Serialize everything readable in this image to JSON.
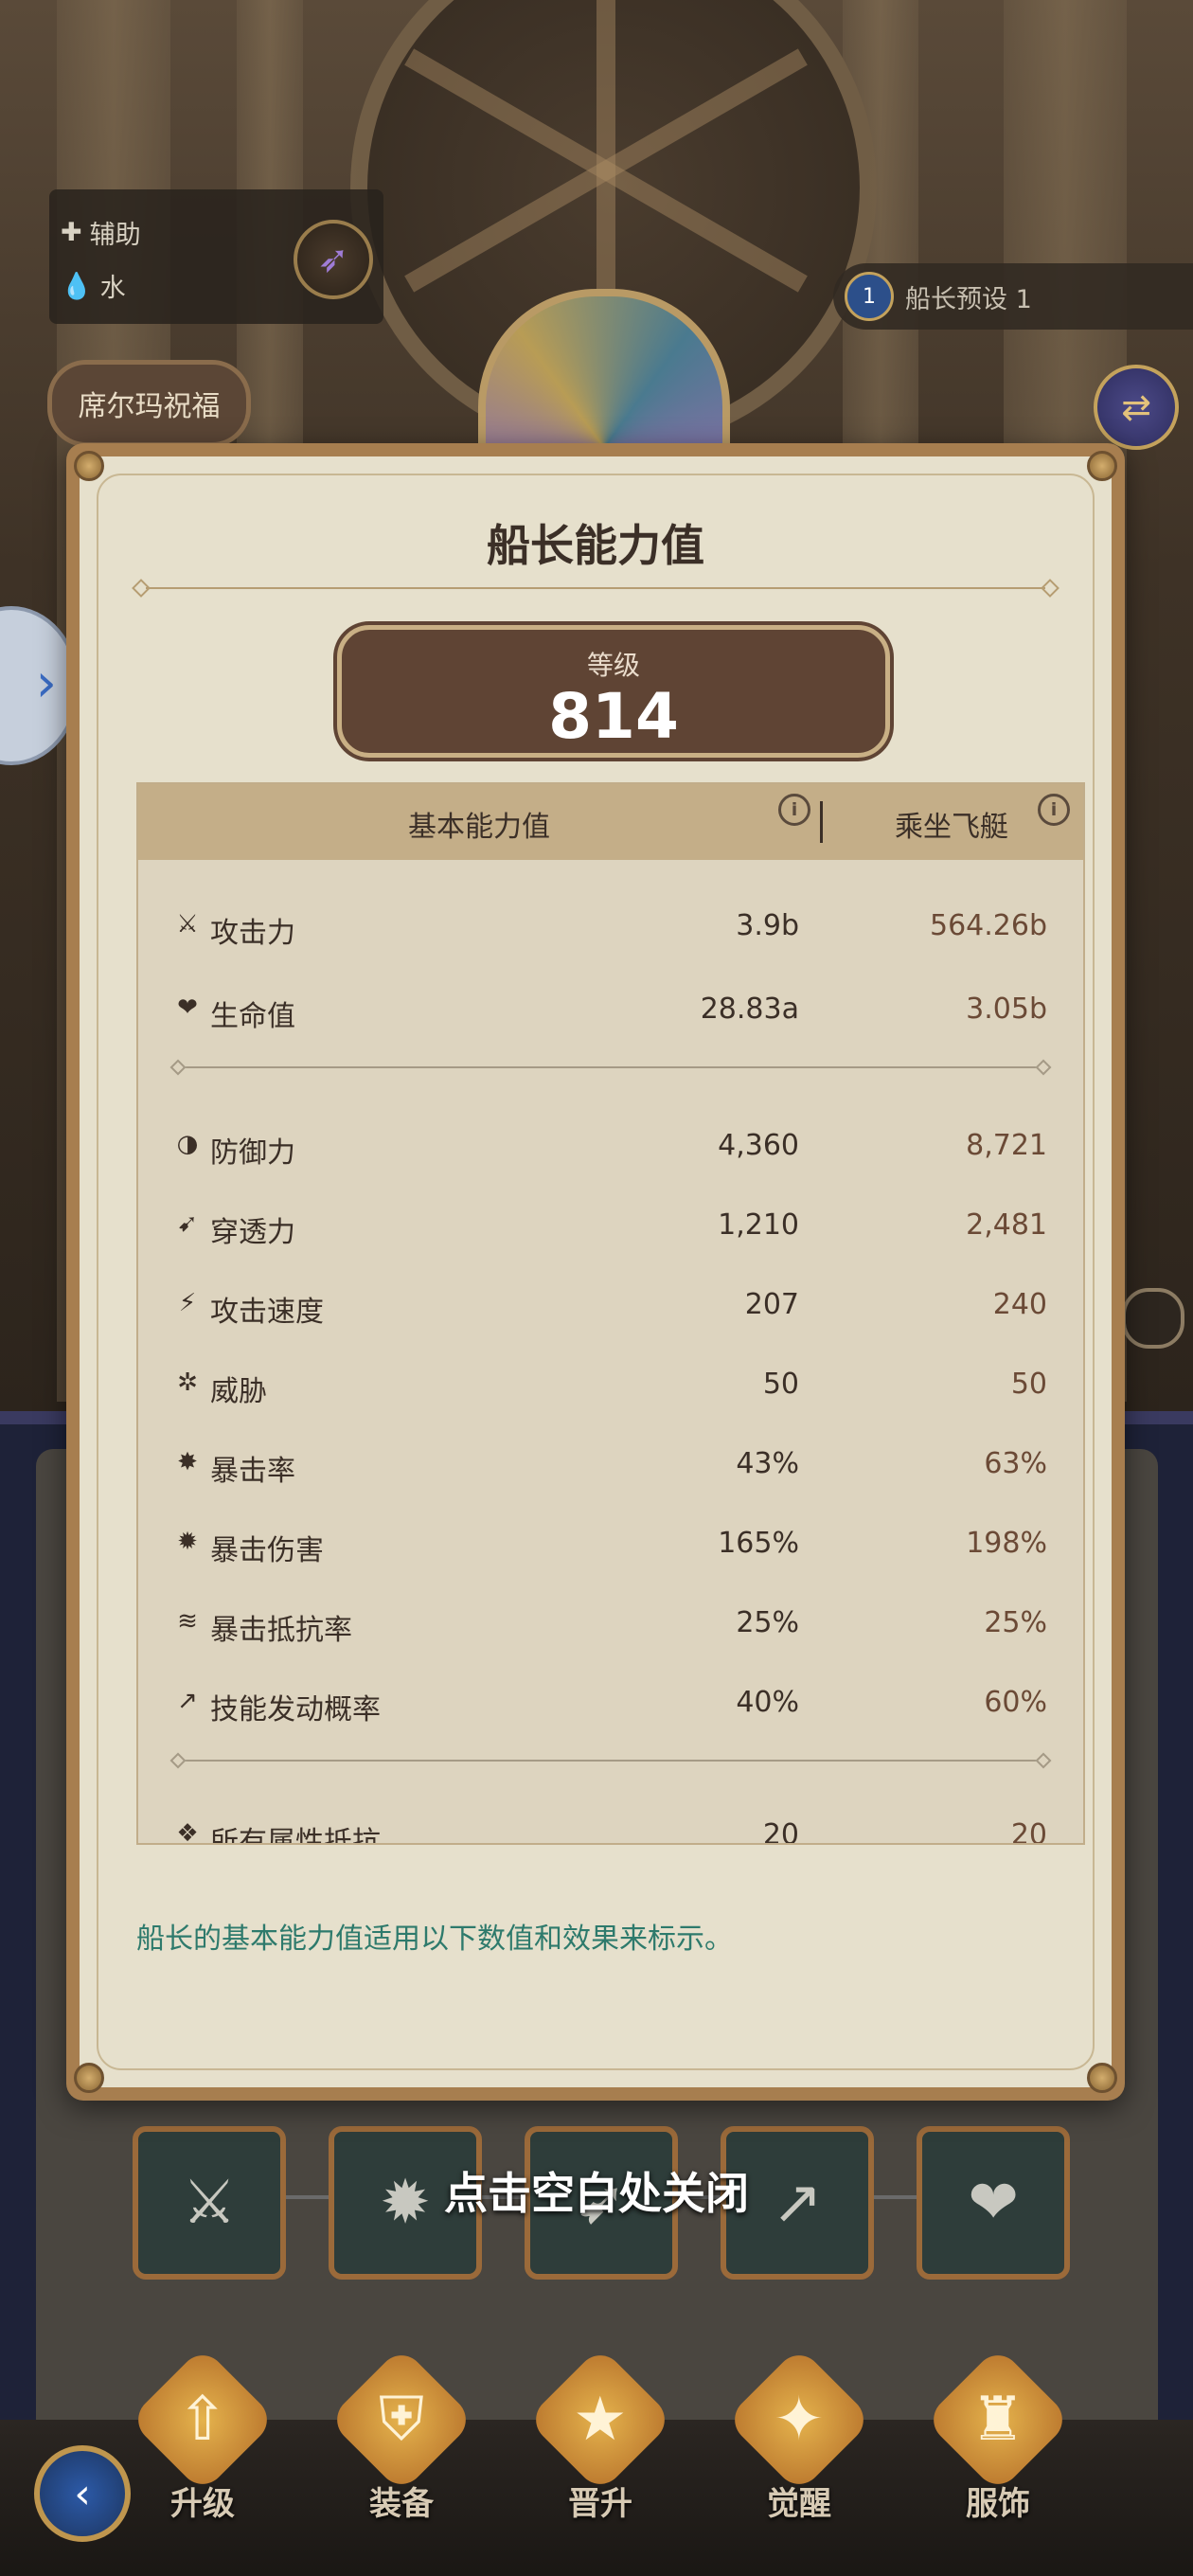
{
  "role": {
    "type": "辅助",
    "element": "水"
  },
  "blessing_button": "席尔玛祝福",
  "preset": {
    "number": "1",
    "label": "船长预设 1"
  },
  "modal": {
    "title": "船长能力值",
    "level_label": "等级",
    "level_value": "814",
    "columns": {
      "base": "基本能力值",
      "ride": "乘坐飞艇"
    },
    "stats_primary": [
      {
        "icon": "sword-icon",
        "glyph": "⚔",
        "name": "攻击力",
        "base": "3.9b",
        "ride": "564.26b"
      },
      {
        "icon": "heart-icon",
        "glyph": "❤",
        "name": "生命值",
        "base": "28.83a",
        "ride": "3.05b"
      }
    ],
    "stats_secondary": [
      {
        "icon": "shield-half-icon",
        "glyph": "◑",
        "name": "防御力",
        "base": "4,360",
        "ride": "8,721"
      },
      {
        "icon": "pierce-icon",
        "glyph": "➹",
        "name": "穿透力",
        "base": "1,210",
        "ride": "2,481"
      },
      {
        "icon": "attack-speed-icon",
        "glyph": "⚡",
        "name": "攻击速度",
        "base": "207",
        "ride": "240"
      },
      {
        "icon": "threat-icon",
        "glyph": "✲",
        "name": "威胁",
        "base": "50",
        "ride": "50"
      },
      {
        "icon": "crit-rate-icon",
        "glyph": "✸",
        "name": "暴击率",
        "base": "43%",
        "ride": "63%"
      },
      {
        "icon": "crit-damage-icon",
        "glyph": "✹",
        "name": "暴击伤害",
        "base": "165%",
        "ride": "198%"
      },
      {
        "icon": "crit-resist-icon",
        "glyph": "≋",
        "name": "暴击抵抗率",
        "base": "25%",
        "ride": "25%"
      },
      {
        "icon": "skill-trigger-icon",
        "glyph": "↗",
        "name": "技能发动概率",
        "base": "40%",
        "ride": "60%"
      }
    ],
    "stats_tertiary": [
      {
        "icon": "all-resist-icon",
        "glyph": "❖",
        "name": "所有属性抵抗",
        "base": "20",
        "ride": "20"
      }
    ],
    "footnote": "船长的基本能力值适用以下数值和效果来标示。"
  },
  "close_hint": "点击空白处关闭",
  "nav": [
    {
      "icon": "upgrade-icon",
      "glyph": "⇧",
      "label": "升级"
    },
    {
      "icon": "equipment-icon",
      "glyph": "⛨",
      "label": "装备"
    },
    {
      "icon": "promote-icon",
      "glyph": "★",
      "label": "晋升"
    },
    {
      "icon": "awaken-icon",
      "glyph": "✦",
      "label": "觉醒"
    },
    {
      "icon": "costume-icon",
      "glyph": "♜",
      "label": "服饰"
    }
  ]
}
